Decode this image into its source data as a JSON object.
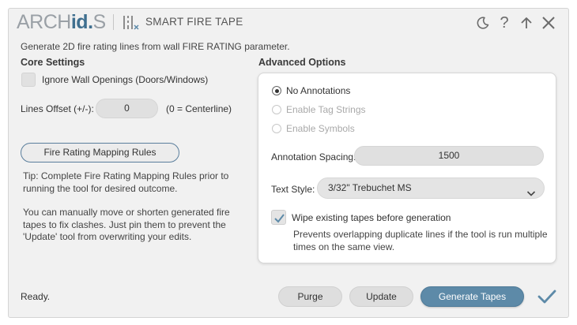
{
  "header": {
    "logo_arch": "ARCH",
    "logo_ids": "id",
    "logo_dot": ".",
    "logo_s": "S",
    "tool_title": "SMART FIRE TAPE",
    "icons": [
      "tape-tool-icon",
      "moon-icon",
      "help-icon",
      "pin-up-icon",
      "close-icon"
    ],
    "help_glyph": "?"
  },
  "subtitle": "Generate 2D fire rating lines from wall FIRE RATING parameter.",
  "core": {
    "title": "Core Settings",
    "ignore_openings_label": "Ignore Wall Openings (Doors/Windows)",
    "ignore_openings_checked": false,
    "lines_offset_label": "Lines Offset (+/-):",
    "lines_offset_value": "0",
    "lines_offset_hint": "(0 = Centerline)",
    "mapping_button": "Fire Rating Mapping Rules",
    "tip": "Tip: Complete Fire Rating Mapping Rules prior to running the tool for desired outcome.",
    "note": "You can manually move or shorten generated fire tapes to fix clashes. Just pin them to prevent the 'Update' tool from overwriting your edits."
  },
  "advanced": {
    "title": "Advanced Options",
    "radio_options": [
      {
        "label": "No Annotations",
        "selected": true,
        "enabled": true
      },
      {
        "label": "Enable Tag Strings",
        "selected": false,
        "enabled": false
      },
      {
        "label": "Enable Symbols",
        "selected": false,
        "enabled": false
      }
    ],
    "spacing_label": "Annotation Spacing:",
    "spacing_value": "1500",
    "text_style_label": "Text Style:",
    "text_style_value": "3/32\" Trebuchet MS",
    "wipe_label": "Wipe existing tapes before generation",
    "wipe_checked": true,
    "wipe_note": "Prevents overlapping duplicate lines if the tool is run multiple times on the same view."
  },
  "footer": {
    "status": "Ready.",
    "purge": "Purge",
    "update": "Update",
    "generate": "Generate Tapes"
  },
  "colors": {
    "accent": "#5d8aa8",
    "brand": "#3f6f8f",
    "outline": "#5a7e9c"
  }
}
